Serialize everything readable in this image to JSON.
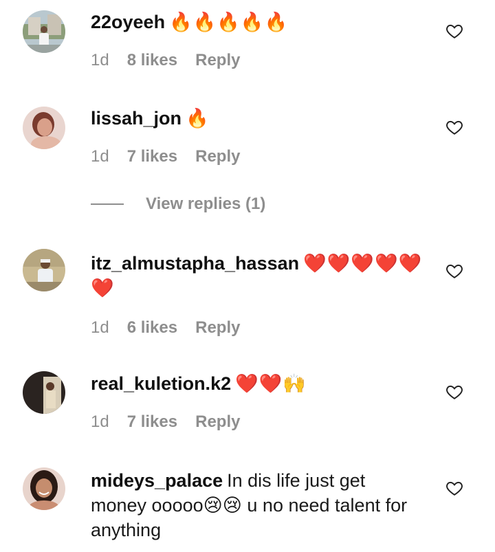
{
  "comments": [
    {
      "username": "22oyeeh",
      "text": "",
      "emoji": "🔥🔥🔥🔥🔥",
      "time": "1d",
      "likes": "8 likes",
      "reply": "Reply"
    },
    {
      "username": "lissah_jon",
      "text": "",
      "emoji": "🔥",
      "time": "1d",
      "likes": "7 likes",
      "reply": "Reply"
    },
    {
      "username": "itz_almustapha_hassan",
      "text": "",
      "emoji": "❤️❤️❤️❤️❤️❤️",
      "time": "1d",
      "likes": "6 likes",
      "reply": "Reply"
    },
    {
      "username": "real_kuletion.k2",
      "text": "",
      "emoji": "❤️❤️🙌",
      "time": "1d",
      "likes": "7 likes",
      "reply": "Reply"
    },
    {
      "username": "mideys_palace",
      "text": "In dis life just get money ooooo😢😢 u no need talent for anything",
      "emoji": ""
    }
  ],
  "view_replies": "View replies (1)",
  "icons": {
    "like": "heart-outline-icon"
  }
}
